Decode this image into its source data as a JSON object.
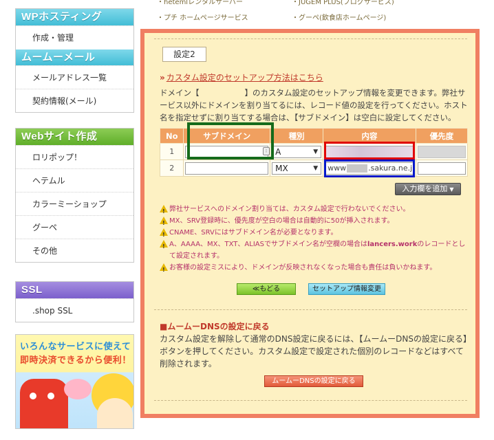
{
  "sidebar": {
    "sections": [
      {
        "title": "WPホスティング",
        "items": [
          "作成・管理"
        ]
      },
      {
        "title": "ムームーメール",
        "items": [
          "メールアドレス一覧",
          "契約情報(メール)"
        ]
      },
      {
        "title": "Webサイト作成",
        "items": [
          "ロリポップ！",
          "ヘテムル",
          "カラーミーショップ",
          "グーペ",
          "その他"
        ]
      },
      {
        "title": "SSL",
        "items": [
          ".shop SSL"
        ]
      }
    ],
    "banner": {
      "line1": "いろんなサービスに使えて",
      "line2": "即時決済できるから便利！"
    }
  },
  "top_links": [
    "・hetemlレンタルサーバー",
    "・JUGEM PLUS(ブログサービス)",
    "・プチ ホームページサービス",
    "・グーペ(飲食店ホームページ)"
  ],
  "main": {
    "setting_title": "設定2",
    "howto_link": "カスタム設定のセットアップ方法はこちら",
    "desc_part1": "ドメイン【",
    "desc_part2": "】のカスタム設定のセットアップ情報を変更できます。弊社サービス以外にドメインを割り当てるには、レコード値の設定を行ってください。ホスト名を指定せずに割り当てする場合は、【サブドメイン】は空白に設定してください。",
    "table": {
      "headers": [
        "No",
        "サブドメイン",
        "種別",
        "内容",
        "優先度"
      ],
      "rows": [
        {
          "no": "1",
          "subdomain": "",
          "type": "A",
          "content": "",
          "priority": ""
        },
        {
          "no": "2",
          "subdomain": "",
          "type": "MX",
          "content_prefix": "www",
          "content_suffix": ".sakura.ne.j",
          "priority": ""
        }
      ]
    },
    "add_button": "入力欄を追加",
    "notes": [
      "弊社サービスへのドメイン割り当ては、カスタム設定で行わないでください。",
      "MX、SRV登録時に、優先度が空白の場合は自動的に50が挿入されます。",
      "CNAME、SRVにはサブドメイン名が必要となります。",
      "A、AAAA、MX、TXT、ALIASでサブドメイン名が空欄の場合は",
      "lancers.work",
      "のレコードとして設定されます。",
      "お客様の設定ミスにより、ドメインが反映されなくなった場合も責任は負いかねます。"
    ],
    "back_button": "≪もどる",
    "change_button": "セットアップ情報変更",
    "revert_title": "■ムームーDNSの設定に戻る",
    "revert_desc": "カスタム設定を解除して通常のDNS設定に戻るには、【ムームーDNSの設定に戻る】ボタンを押してください。カスタム設定で設定された個別のレコードなどはすべて削除されます。",
    "revert_button": "ムームーDNSの設定に戻る"
  },
  "colors": {
    "panel_border": "#f07f62",
    "panel_bg": "#fdf1c3",
    "table_header": "#f0a060",
    "link": "#c0392b",
    "note": "#b5316a",
    "highlight_green": "#156b1b",
    "highlight_red": "#e00000",
    "highlight_blue": "#0018c8"
  }
}
